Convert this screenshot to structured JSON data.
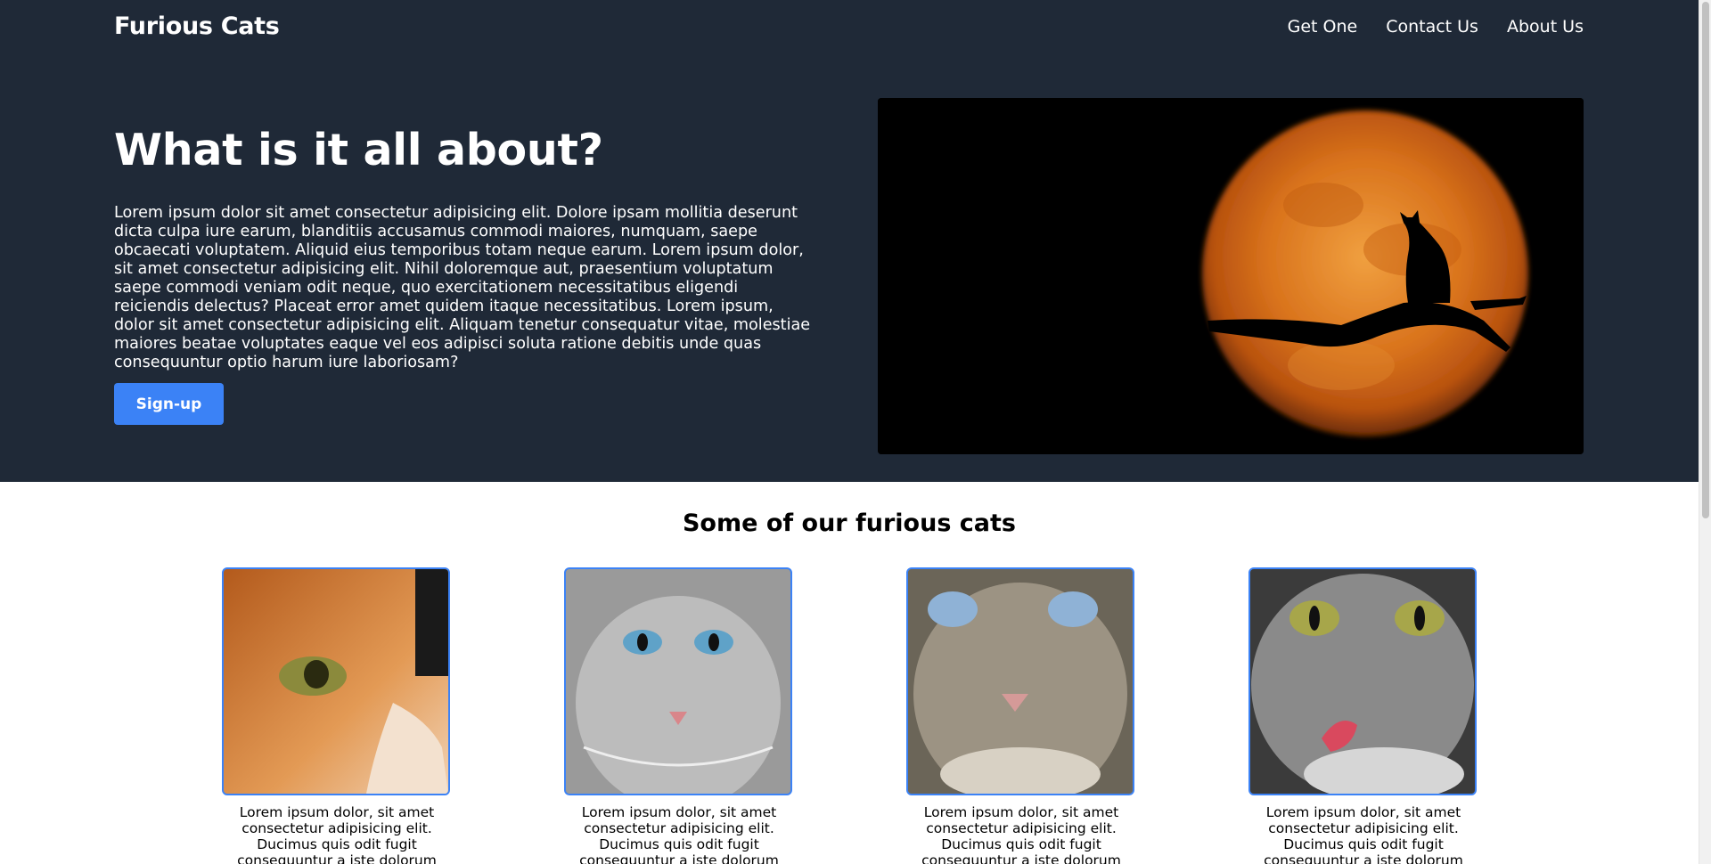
{
  "nav": {
    "brand": "Furious Cats",
    "links": [
      "Get One",
      "Contact Us",
      "About Us"
    ]
  },
  "hero": {
    "title": "What is it all about?",
    "text": "Lorem ipsum dolor sit amet consectetur adipisicing elit. Dolore ipsam mollitia deserunt dicta culpa iure earum, blanditiis accusamus commodi maiores, numquam, saepe obcaecati voluptatem. Aliquid eius temporibus totam neque earum. Lorem ipsum dolor, sit amet consectetur adipisicing elit. Nihil doloremque aut, praesentium voluptatum saepe commodi veniam odit neque, quo exercitationem necessitatibus eligendi reiciendis delectus? Placeat error amet quidem itaque necessitatibus. Lorem ipsum, dolor sit amet consectetur adipisicing elit. Aliquam tenetur consequatur vitae, molestiae maiores beatae voluptates eaque vel eos adipisci soluta ratione debitis unde quas consequuntur optio harum iure laboriosam?",
    "button_label": "Sign-up"
  },
  "cats_section": {
    "title": "Some of our furious cats",
    "cards": [
      {
        "text": "Lorem ipsum dolor, sit amet consectetur adipisicing elit. Ducimus quis odit fugit consequuntur a iste dolorum"
      },
      {
        "text": "Lorem ipsum dolor, sit amet consectetur adipisicing elit. Ducimus quis odit fugit consequuntur a iste dolorum"
      },
      {
        "text": "Lorem ipsum dolor, sit amet consectetur adipisicing elit. Ducimus quis odit fugit consequuntur a iste dolorum"
      },
      {
        "text": "Lorem ipsum dolor, sit amet consectetur adipisicing elit. Ducimus quis odit fugit consequuntur a iste dolorum"
      }
    ]
  },
  "colors": {
    "header_bg": "#1f2937",
    "accent": "#3b82f6"
  }
}
